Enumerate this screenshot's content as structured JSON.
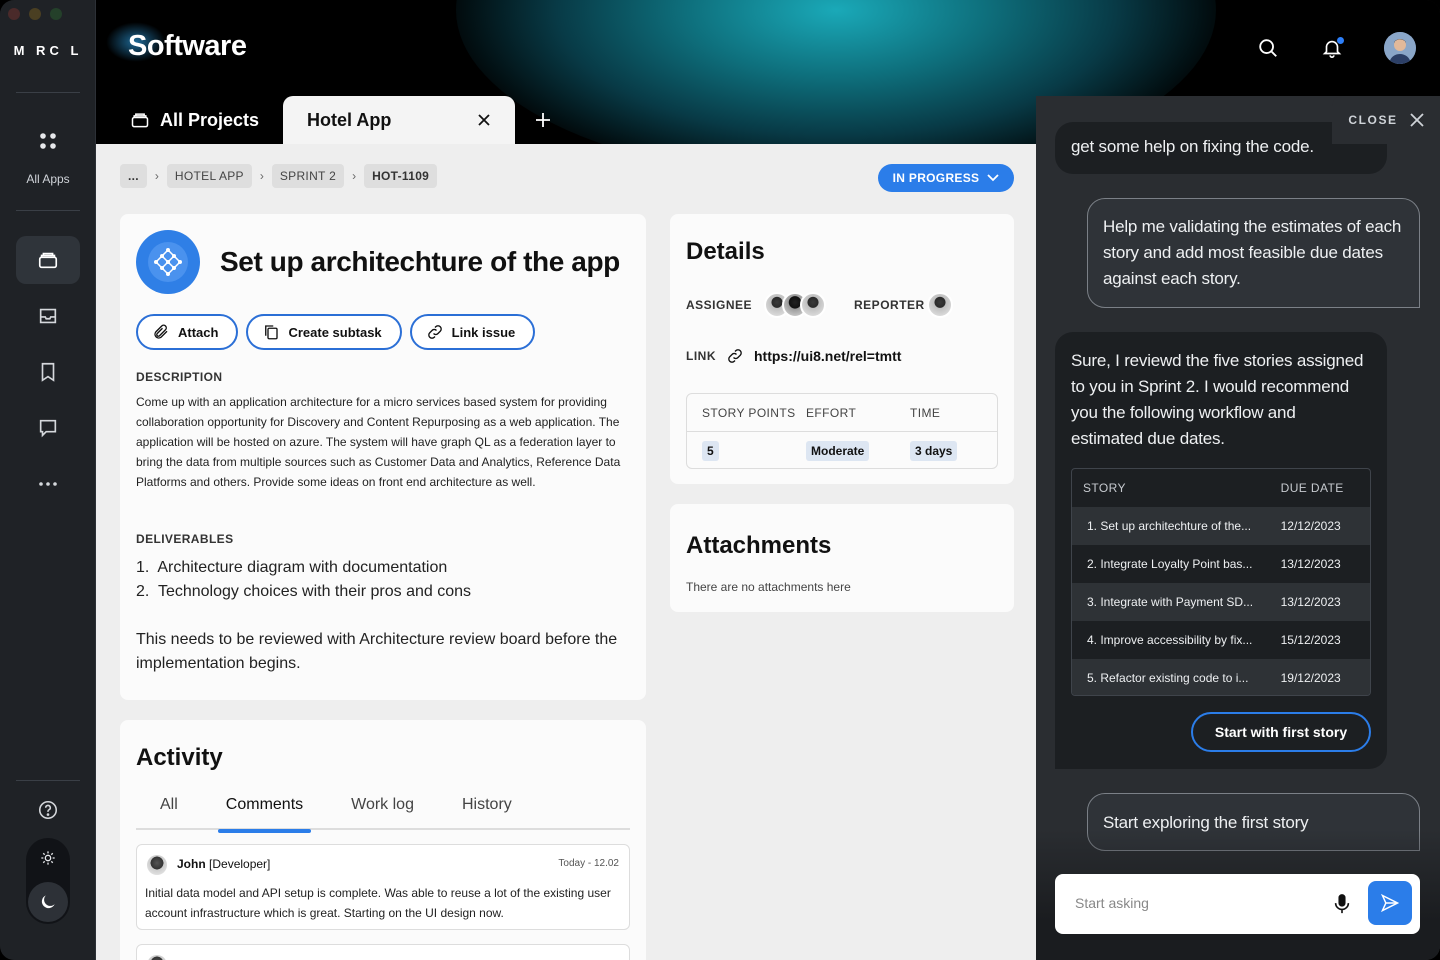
{
  "window": {
    "traffic_colors": [
      "#4a2a2a",
      "#4a3f22",
      "#24402a"
    ]
  },
  "sidebar": {
    "logo": "M RC L",
    "all_apps_label": "All Apps",
    "items": [
      {
        "icon": "projects-icon",
        "active": true
      },
      {
        "icon": "inbox-icon",
        "active": false
      },
      {
        "icon": "bookmark-icon",
        "active": false
      },
      {
        "icon": "chat-icon",
        "active": false
      },
      {
        "icon": "more-icon",
        "active": false
      }
    ]
  },
  "header": {
    "title": "Software",
    "tabs": [
      {
        "label": "All Projects",
        "active": false
      },
      {
        "label": "Hotel App",
        "active": true
      }
    ]
  },
  "breadcrumb": [
    "...",
    "HOTEL APP",
    "SPRINT 2",
    "HOT-1109"
  ],
  "status": {
    "label": "IN PROGRESS",
    "color": "#2b7de9"
  },
  "issue": {
    "title": "Set up architechture of the app",
    "actions": [
      "Attach",
      "Create subtask",
      "Link issue"
    ],
    "description_label": "DESCRIPTION",
    "description": "Come up with an application architecture for a micro services based system for providing collaboration opportunity for Discovery and Content Repurposing as a web application. The application will be hosted on azure. The system will have graph QL as a federation layer to bring the data from multiple sources such as Customer Data and Analytics, Reference Data Platforms and others. Provide some ideas on front end architecture as well.",
    "deliverables_label": "DELIVERABLES",
    "deliverables": [
      "1.  Architecture diagram with documentation",
      "2.  Technology choices with their pros and cons"
    ],
    "note": "This needs to be reviewed with Architecture review board before the implementation begins."
  },
  "activity": {
    "title": "Activity",
    "tabs": [
      "All",
      "Comments",
      "Work log",
      "History"
    ],
    "active_tab": "Comments",
    "comments": [
      {
        "author": "John",
        "role": "[Developer]",
        "time": "Today - 12.02",
        "text": "Initial data model and API setup is complete. Was able to reuse a lot of the existing user account infrastructure which is great. Starting on the UI design now."
      }
    ]
  },
  "details": {
    "title": "Details",
    "assignee_label": "ASSIGNEE",
    "reporter_label": "REPORTER",
    "link_label": "LINK",
    "link_url": "https://ui8.net/rel=tmtt",
    "columns": [
      "STORY POINTS",
      "EFFORT",
      "TIME"
    ],
    "values": [
      "5",
      "Moderate",
      "3 days"
    ]
  },
  "attachments": {
    "title": "Attachments",
    "empty": "There are no attachments here"
  },
  "assistant": {
    "close_label": "CLOSE",
    "partial_msg": "get some help on fixing the code.",
    "user_msg_1": "Help me validating the estimates of each story and add most feasible due dates against each story.",
    "ai_msg": "Sure, I reviewd the five stories assigned to you in Sprint 2. I would recommend you the following workflow and estimated due dates.",
    "table_headers": [
      "STORY",
      "DUE DATE"
    ],
    "stories": [
      {
        "story": "1. Set up architechture of the...",
        "due": "12/12/2023"
      },
      {
        "story": "2. Integrate Loyalty Point bas...",
        "due": "13/12/2023"
      },
      {
        "story": "3. Integrate with Payment SD...",
        "due": "13/12/2023"
      },
      {
        "story": "4. Improve accessibility by fix...",
        "due": "15/12/2023"
      },
      {
        "story": "5. Refactor existing code to i...",
        "due": "19/12/2023"
      }
    ],
    "start_button": "Start with first story",
    "user_msg_2": "Start exploring the first story",
    "input_placeholder": "Start asking"
  }
}
